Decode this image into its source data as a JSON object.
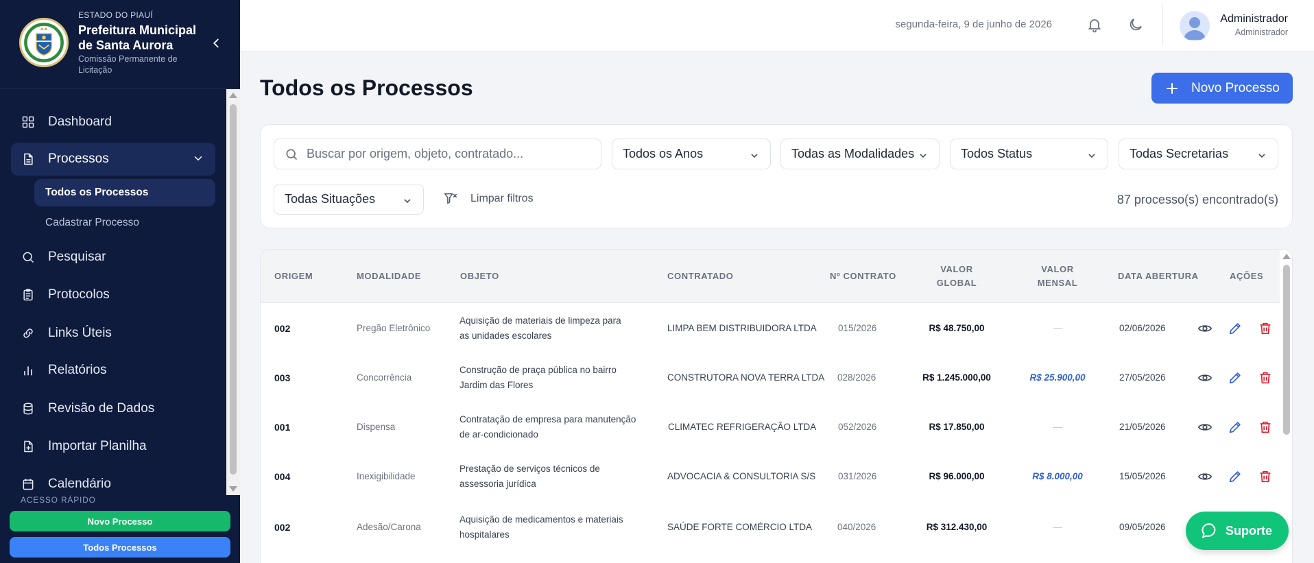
{
  "brand": {
    "state": "ESTADO DO PIAUÍ",
    "city": "Prefeitura Municipal de Santa Aurora",
    "commission": "Comissão Permanente de Licitação"
  },
  "nav": {
    "dashboard": "Dashboard",
    "processos": "Processos",
    "todos_processos": "Todos os Processos",
    "cadastrar_processo": "Cadastrar Processo",
    "pesquisar": "Pesquisar",
    "protocolos": "Protocolos",
    "links_uteis": "Links Úteis",
    "relatorios": "Relatórios",
    "revisao_dados": "Revisão de Dados",
    "importar_planilha": "Importar Planilha",
    "calendario": "Calendário"
  },
  "quick_access": {
    "label": "ACESSO RÁPIDO",
    "novo_processo": "Novo Processo",
    "todos_processos": "Todos Processos"
  },
  "header": {
    "date": "segunda-feira, 9 de junho de 2026",
    "user_name": "Administrador",
    "user_role": "Administrador"
  },
  "page": {
    "title": "Todos os Processos",
    "new_button": "Novo Processo"
  },
  "filters": {
    "search_placeholder": "Buscar por origem, objeto, contratado...",
    "anos": "Todos os Anos",
    "modalidades": "Todas as Modalidades",
    "status": "Todos Status",
    "secretarias": "Todas Secretarias",
    "situacoes": "Todas Situações",
    "clear": "Limpar filtros",
    "count": "87 processo(s) encontrado(s)"
  },
  "table": {
    "headers": {
      "origem": "ORIGEM",
      "modalidade": "MODALIDADE",
      "objeto": "OBJETO",
      "contratado": "CONTRATADO",
      "n_contrato": "Nº CONTRATO",
      "valor_global_1": "VALOR",
      "valor_global_2": "GLOBAL",
      "valor_mensal_1": "VALOR",
      "valor_mensal_2": "MENSAL",
      "data_abertura": "DATA ABERTURA",
      "acoes": "AÇÕES"
    },
    "rows": [
      {
        "origem": "002",
        "modalidade": "Pregão Eletrônico",
        "objeto_1": "Aquisição de materiais de limpeza para",
        "objeto_2": "as unidades escolares",
        "contratado": "LIMPA BEM DISTRIBUIDORA LTDA",
        "contrato": "015/2026",
        "valor_global": "R$ 48.750,00",
        "valor_mensal": "—",
        "data": "02/06/2026"
      },
      {
        "origem": "003",
        "modalidade": "Concorrência",
        "objeto_1": "Construção de praça pública no bairro",
        "objeto_2": "Jardim das Flores",
        "contratado": "CONSTRUTORA NOVA TERRA LTDA",
        "contrato": "028/2026",
        "valor_global": "R$ 1.245.000,00",
        "valor_mensal": "R$ 25.900,00",
        "data": "27/05/2026"
      },
      {
        "origem": "001",
        "modalidade": "Dispensa",
        "objeto_1": "Contratação de empresa para manutenção",
        "objeto_2": "de ar-condicionado",
        "contratado": "CLIMATEC REFRIGERAÇÃO LTDA",
        "contrato": "052/2026",
        "valor_global": "R$ 17.850,00",
        "valor_mensal": "—",
        "data": "21/05/2026"
      },
      {
        "origem": "004",
        "modalidade": "Inexigibilidade",
        "objeto_1": "Prestação de serviços técnicos de",
        "objeto_2": "assessoria jurídica",
        "contratado": "ADVOCACIA & CONSULTORIA S/S",
        "contrato": "031/2026",
        "valor_global": "R$ 96.000,00",
        "valor_mensal": "R$ 8.000,00",
        "data": "15/05/2026"
      },
      {
        "origem": "002",
        "modalidade": "Adesão/Carona",
        "objeto_1": "Aquisição de medicamentos e materiais",
        "objeto_2": "hospitalares",
        "contratado": "SAÚDE FORTE COMÉRCIO LTDA",
        "contrato": "040/2026",
        "valor_global": "R$ 312.430,00",
        "valor_mensal": "—",
        "data": "09/05/2026"
      }
    ]
  },
  "support": {
    "label": "Suporte"
  },
  "icons": {
    "dashboard": "grid-icon",
    "processos": "document-icon",
    "pesquisar": "search-icon",
    "protocolos": "clipboard-icon",
    "links": "link-icon",
    "relatorios": "bar-chart-icon",
    "revisao": "database-icon",
    "importar": "file-plus-icon",
    "calendario": "calendar-icon",
    "view": "eye-icon",
    "edit": "pencil-icon",
    "delete": "trash-icon"
  },
  "colors": {
    "sidebar_bg": "#0f1b3d",
    "primary": "#3b6ee8",
    "success": "#10c57a",
    "danger": "#e11d2e",
    "mensal": "#2f5fd6"
  }
}
